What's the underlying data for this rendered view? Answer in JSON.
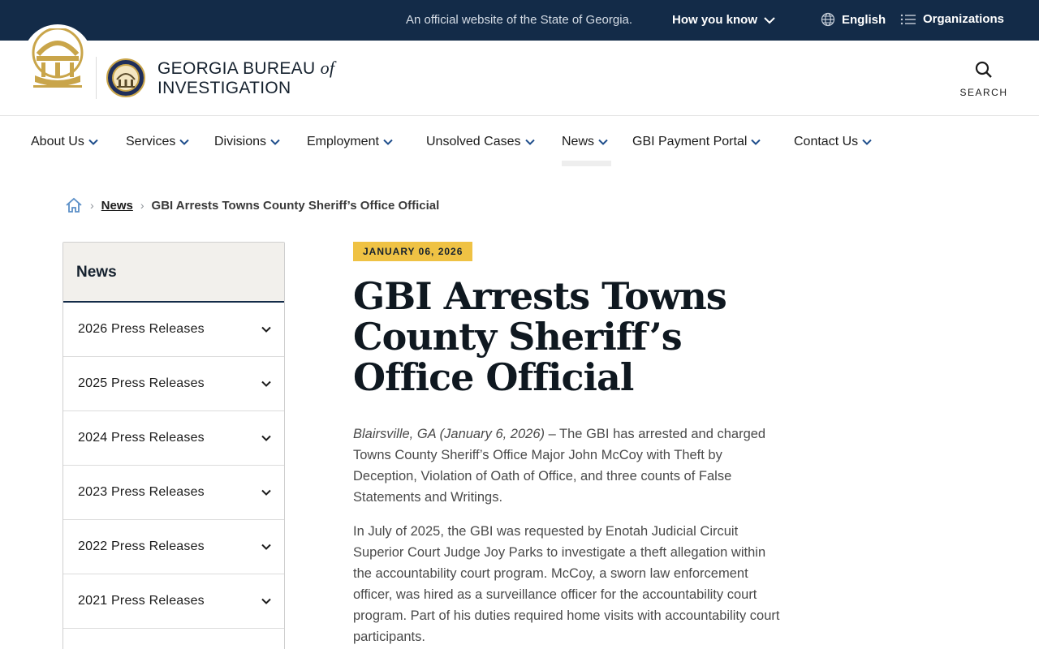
{
  "banner": {
    "official_text": "An official website of the State of Georgia.",
    "how_you_know": "How you know",
    "language": "English",
    "organizations": "Organizations"
  },
  "header": {
    "site_name_line1": "GEORGIA BUREAU",
    "site_name_of": "of",
    "site_name_line2": "INVESTIGATION",
    "search_label": "SEARCH"
  },
  "nav": {
    "items": [
      {
        "label": "About Us"
      },
      {
        "label": "Services"
      },
      {
        "label": "Divisions"
      },
      {
        "label": "Employment"
      },
      {
        "label": "Unsolved Cases"
      },
      {
        "label": "News"
      },
      {
        "label": "GBI Payment Portal"
      },
      {
        "label": "Contact Us"
      }
    ],
    "active": "News"
  },
  "breadcrumb": {
    "parent": "News",
    "current": "GBI Arrests Towns County Sheriff’s Office Official"
  },
  "sidebar": {
    "title": "News",
    "items": [
      {
        "label": "2026 Press Releases"
      },
      {
        "label": "2025 Press Releases"
      },
      {
        "label": "2024 Press Releases"
      },
      {
        "label": "2023 Press Releases"
      },
      {
        "label": "2022 Press Releases"
      },
      {
        "label": "2021 Press Releases"
      }
    ]
  },
  "article": {
    "date": "JANUARY 06, 2026",
    "title": "GBI Arrests Towns County Sheriff’s Office Official",
    "dateline": "Blairsville, GA (January 6, 2026)",
    "p1_rest": " – The GBI has arrested and charged Towns County Sheriff’s Office Major John McCoy with Theft by Deception, Violation of Oath of Office, and three counts of False Statements and Writings.",
    "p2": "In July of 2025, the GBI was requested by Enotah Judicial Circuit Superior Court Judge Joy Parks to investigate a theft allegation within the accountability court program. McCoy, a sworn law enforcement officer, was hired as a surveillance officer for the accountability court program. Part of his duties required home visits with accountability court participants."
  },
  "colors": {
    "navy": "#132b48",
    "gold": "#efc244",
    "seal_gold": "#c9a54a"
  }
}
